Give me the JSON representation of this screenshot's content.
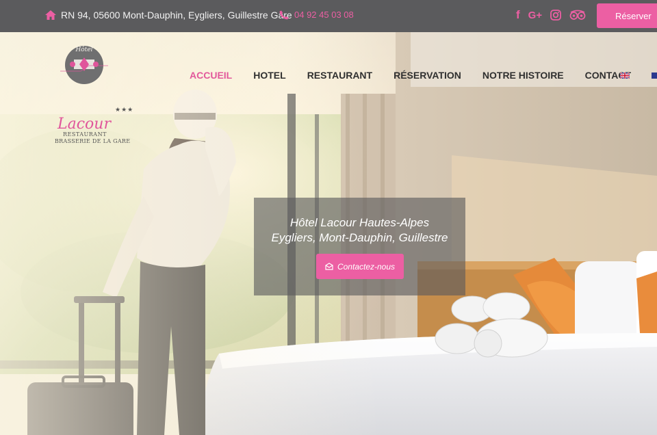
{
  "topbar": {
    "address": "RN 94, 05600 Mont-Dauphin, Eygliers, Guillestre Gare",
    "phone": "04 92 45 03 08",
    "social": [
      {
        "icon": "facebook-icon",
        "glyph": "f"
      },
      {
        "icon": "google-plus-icon",
        "glyph": "G+"
      },
      {
        "icon": "instagram-icon",
        "glyph": ""
      },
      {
        "icon": "tripadvisor-icon",
        "glyph": ""
      }
    ],
    "reserve_label": "Réserver"
  },
  "logo": {
    "script_text": "Hôtel",
    "name": "Lacour",
    "stars": "★★★",
    "subtitle1": "RESTAURANT",
    "subtitle2": "BRASSERIE DE LA GARE"
  },
  "nav": {
    "items": [
      "ACCUEIL",
      "HOTEL",
      "RESTAURANT",
      "RÉSERVATION",
      "NOTRE HISTOIRE",
      "CONTACT"
    ],
    "active_index": 0
  },
  "hero": {
    "title_line1": "Hôtel Lacour Hautes-Alpes",
    "title_line2": "Eygliers, Mont-Dauphin, Guillestre",
    "contact_label": "Contactez-nous"
  },
  "colors": {
    "accent": "#ec5fa3",
    "topbar": "#5b5b5d",
    "nav_text": "#2f2f2f"
  }
}
